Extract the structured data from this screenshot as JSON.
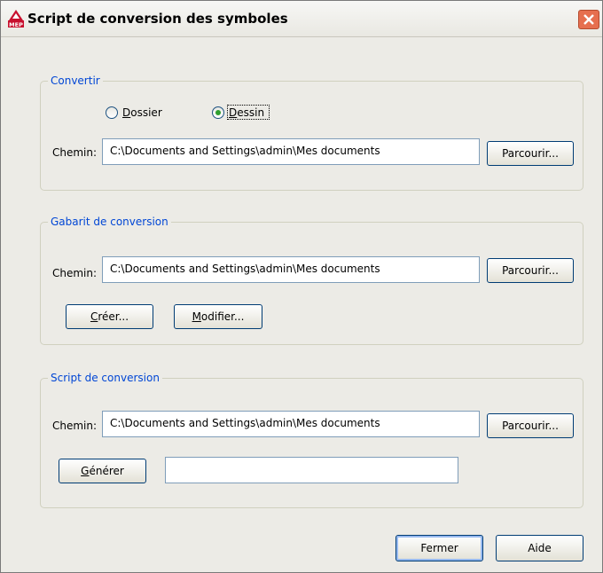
{
  "window": {
    "title": "Script de conversion des symboles",
    "app_icon": "autocad-mep-icon",
    "close_icon": "close-icon"
  },
  "convertir": {
    "legend": "Convertir",
    "radio_dossier": {
      "label_prefix": "",
      "label_mnemonic": "D",
      "label_rest": "ossier",
      "checked": false
    },
    "radio_dessin": {
      "label_prefix": "",
      "label_mnemonic": "D",
      "label_rest": "essin",
      "checked": true
    },
    "path_label": "Chemin:",
    "path_value": "C:\\Documents and Settings\\admin\\Mes documents",
    "browse_label": "Parcourir..."
  },
  "gabarit": {
    "legend": "Gabarit de conversion",
    "path_label": "Chemin:",
    "path_value": "C:\\Documents and Settings\\admin\\Mes documents",
    "browse_label": "Parcourir...",
    "create": {
      "mnemonic": "C",
      "rest": "réer..."
    },
    "modify": {
      "mnemonic": "M",
      "rest": "odifier..."
    }
  },
  "script": {
    "legend": "Script de conversion",
    "path_label": "Chemin:",
    "path_value": "C:\\Documents and Settings\\admin\\Mes documents",
    "browse_label": "Parcourir...",
    "generate": {
      "mnemonic": "G",
      "rest": "énérer"
    },
    "output_value": ""
  },
  "footer": {
    "close_label": "Fermer",
    "help_label": "Aide"
  },
  "colors": {
    "legend": "#0046d5",
    "window_bg": "#ecebe6",
    "close_button": "#e66f4f",
    "radio_dot": "#2e9e2e"
  }
}
